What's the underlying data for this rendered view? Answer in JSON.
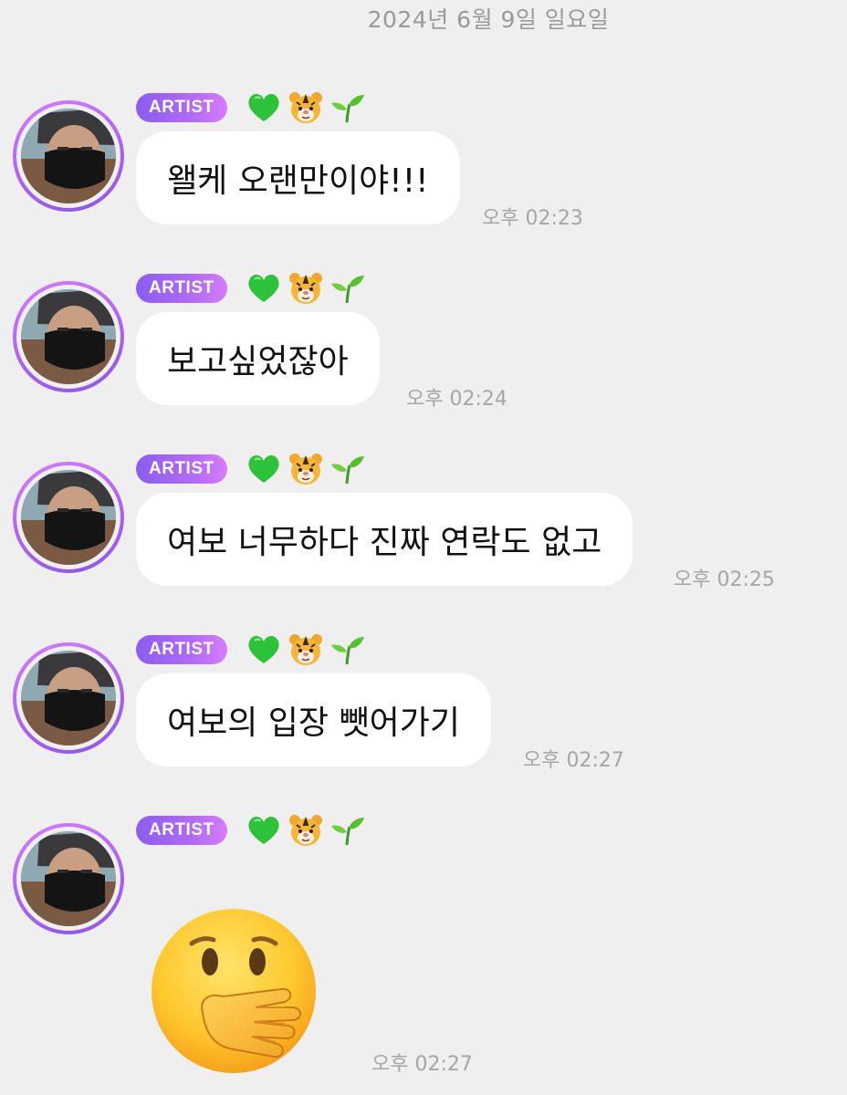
{
  "date_header": "2024년 6월 9일 일요일",
  "badge_label": "ARTIST",
  "icons": [
    "green-heart-icon",
    "tiger-face-icon",
    "seedling-icon"
  ],
  "messages": [
    {
      "text": "왤케 오랜만이야!!!",
      "time": "오후 02:23"
    },
    {
      "text": "보고싶었잖아",
      "time": "오후 02:24"
    },
    {
      "text": "여보 너무하다 진짜 연락도 없고",
      "time": "오후 02:25"
    },
    {
      "text": "여보의 입장 뺏어가기",
      "time": "오후 02:27"
    },
    {
      "emoji": "face-with-hand-over-mouth-icon",
      "time": "오후 02:27"
    }
  ]
}
